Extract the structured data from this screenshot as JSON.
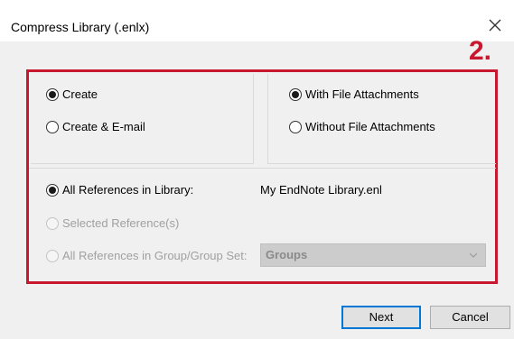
{
  "window": {
    "title": "Compress Library (.enlx)",
    "close_glyph": "✕"
  },
  "annotation": {
    "label": "2.",
    "color": "#c8182f"
  },
  "output_group": {
    "create_label": "Create",
    "create_checked": true,
    "create_email_label": "Create & E-mail",
    "create_email_checked": false
  },
  "attachments_group": {
    "with_label": "With File Attachments",
    "with_checked": true,
    "without_label": "Without File Attachments",
    "without_checked": false
  },
  "references_group": {
    "all_label": "All References in Library:",
    "all_checked": true,
    "library_name": "My EndNote Library.enl",
    "selected_label": "Selected Reference(s)",
    "selected_enabled": false,
    "group_label": "All References in Group/Group Set:",
    "group_enabled": false,
    "group_select_value": "Groups"
  },
  "buttons": {
    "next_label": "Next",
    "cancel_label": "Cancel"
  }
}
